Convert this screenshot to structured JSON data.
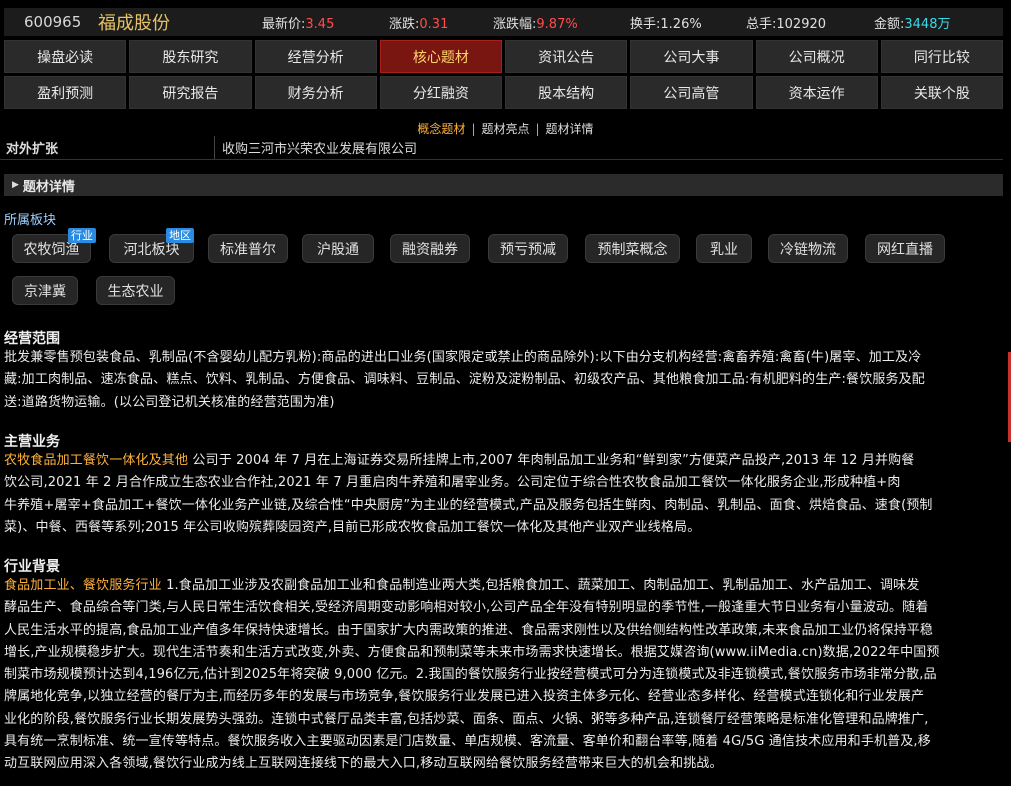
{
  "quote": {
    "code": "600965",
    "name": "福成股份",
    "price_label": "最新价:",
    "price": "3.45",
    "change_label": "涨跌:",
    "change": "0.31",
    "pct_label": "涨跌幅:",
    "pct": "9.87%",
    "turnover_label": "换手:",
    "turnover": "1.26%",
    "volume_label": "总手:",
    "volume": "102920",
    "amount_label": "金额:",
    "amount": "3448万"
  },
  "nav": {
    "row1": [
      "操盘必读",
      "股东研究",
      "经营分析",
      "核心题材",
      "资讯公告",
      "公司大事",
      "公司概况",
      "同行比较"
    ],
    "row2": [
      "盈利预测",
      "研究报告",
      "财务分析",
      "分红融资",
      "股本结构",
      "公司高管",
      "资本运作",
      "关联个股"
    ]
  },
  "subtabs": [
    "概念题材",
    "题材亮点",
    "题材详情"
  ],
  "clipped_row": {
    "label": "对外扩张",
    "value": "收购三河市兴荣农业发展有限公司"
  },
  "section_title": "题材详情",
  "plates_label": "所属板块",
  "tags": [
    "农牧饲渔",
    "河北板块",
    "标准普尔",
    "沪股通",
    "融资融券",
    "预亏预减",
    "预制菜概念",
    "乳业",
    "冷链物流",
    "网红直播",
    "京津冀",
    "生态农业"
  ],
  "badges": {
    "industry": "行业",
    "region": "地区"
  },
  "business_scope": {
    "title": "经营范围",
    "lines": [
      "批发兼零售预包装食品、乳制品(不含婴幼儿配方乳粉):商品的进出口业务(国家限定或禁止的商品除外):以下由分支机构经营:禽畜养殖:禽畜(牛)屠宰、加工及冷",
      "藏:加工肉制品、速冻食品、糕点、饮料、乳制品、方便食品、调味料、豆制品、淀粉及淀粉制品、初级农产品、其他粮食加工品:有机肥料的生产:餐饮服务及配",
      "送:道路货物运输。(以公司登记机关核准的经营范围为准)"
    ]
  },
  "main_business": {
    "title": "主营业务",
    "highlight": "农牧食品加工餐饮一体化及其他",
    "lines": [
      "  公司于 2004 年 7 月在上海证券交易所挂牌上市,2007 年肉制品加工业务和“鲜到家”方便菜产品投产,2013 年 12 月并购餐",
      "饮公司,2021 年 2 月合作成立生态农业合作社,2021 年 7 月重启肉牛养殖和屠宰业务。公司定位于综合性农牧食品加工餐饮一体化服务企业,形成种植+肉",
      "牛养殖+屠宰+食品加工+餐饮一体化业务产业链,及综合性“中央厨房”为主业的经营模式,产品及服务包括生鲜肉、肉制品、乳制品、面食、烘焙食品、速食(预制",
      "菜)、中餐、西餐等系列;2015 年公司收购殡葬陵园资产,目前已形成农牧食品加工餐饮一体化及其他产业双产业线格局。"
    ]
  },
  "industry_background": {
    "title": "行业背景",
    "highlight": "食品加工业、餐饮服务行业",
    "lines": [
      "  1.食品加工业涉及农副食品加工业和食品制造业两大类,包括粮食加工、蔬菜加工、肉制品加工、乳制品加工、水产品加工、调味发",
      "酵品生产、食品综合等门类,与人民日常生活饮食相关,受经济周期变动影响相对较小,公司产品全年没有特别明显的季节性,一般逢重大节日业务有小量波动。随着",
      "人民生活水平的提高,食品加工业产值多年保持快速增长。由于国家扩大内需政策的推进、食品需求刚性以及供给侧结构性改革政策,未来食品加工业仍将保持平稳",
      "增长,产业规模稳步扩大。现代生活节奏和生活方式改变,外卖、方便食品和预制菜等未来市场需求快速增长。根据艾媒咨询(www.iiMedia.cn)数据,2022年中国预",
      "制菜市场规模预计达到4,196亿元,估计到2025年将突破 9,000 亿元。2.我国的餐饮服务行业按经营模式可分为连锁模式及非连锁模式,餐饮服务市场非常分散,品",
      "牌属地化竞争,以独立经营的餐厅为主,而经历多年的发展与市场竞争,餐饮服务行业发展已进入投资主体多元化、经营业态多样化、经营模式连锁化和行业发展产",
      "业化的阶段,餐饮服务行业长期发展势头强劲。连锁中式餐厅品类丰富,包括炒菜、面条、面点、火锅、粥等多种产品,连锁餐厅经营策略是标准化管理和品牌推广,",
      "具有统一烹制标准、统一宣传等特点。餐饮服务收入主要驱动因素是门店数量、单店规模、客流量、客单价和翻台率等,随着 4G/5G 通信技术应用和手机普及,移",
      "动互联网应用深入各领域,餐饮行业成为线上互联网连接线下的最大入口,移动互联网给餐饮服务经营带来巨大的机会和挑战。"
    ]
  }
}
